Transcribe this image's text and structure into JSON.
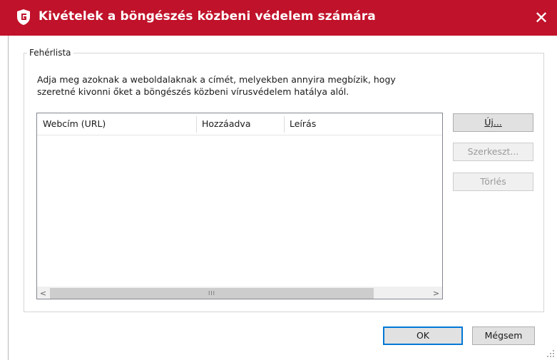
{
  "window": {
    "title": "Kivételek a böngészés közbeni védelem számára",
    "close_glyph": "✕",
    "icon": "g-data-shield-icon",
    "accent_color": "#c0122a"
  },
  "whitelist": {
    "group_label": "Fehérlista",
    "description_line1": "Adja meg azoknak a weboldalaknak a címét, melyekben annyira megbízik, hogy",
    "description_line2": "szeretné kivonni őket a böngészés közbeni vírusvédelem hatálya alól.",
    "columns": [
      "Webcím (URL)",
      "Hozzáadva",
      "Leírás"
    ],
    "rows": [],
    "scroll_left_glyph": "<",
    "scroll_right_glyph": ">",
    "scroll_grip_glyph": "III"
  },
  "buttons": {
    "new_label": "Új...",
    "edit_label": "Szerkeszt...",
    "delete_label": "Törlés",
    "ok_label": "OK",
    "cancel_label": "Mégsem"
  }
}
